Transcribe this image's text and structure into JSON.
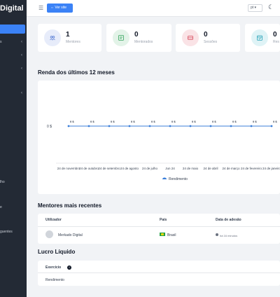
{
  "sidebar": {
    "brand": "Digital",
    "items": [
      {
        "label": "",
        "chevron": ""
      },
      {
        "label": "s",
        "chevron": "‹"
      },
      {
        "label": "",
        "chevron": "‹"
      },
      {
        "label": "",
        "chevron": "‹"
      },
      {
        "label": "",
        "chevron": "‹"
      },
      {
        "label": "lho",
        "chevron": ""
      },
      {
        "label": "e",
        "chevron": ""
      },
      {
        "label": "guentes",
        "chevron": ""
      }
    ]
  },
  "topbar": {
    "visit_label": "⇔ Ver site",
    "language": "pt ▾",
    "theme_icon": "moon-icon"
  },
  "stats": [
    {
      "value": "1",
      "label": "Mentores",
      "icon": "users-icon",
      "color": "#5b7fd6",
      "bg": "#e7ecfa"
    },
    {
      "value": "0",
      "label": "Mentorados",
      "icon": "user-card-icon",
      "color": "#33a35b",
      "bg": "#e3f3e8"
    },
    {
      "value": "0",
      "label": "Sessões",
      "icon": "session-icon",
      "color": "#d7485a",
      "bg": "#fae3e6"
    },
    {
      "value": "0",
      "label": "Res",
      "icon": "calendar-icon",
      "color": "#2aa3b8",
      "bg": "#dff3f6"
    }
  ],
  "income_section": {
    "title": "Renda dos últimos 12 meses"
  },
  "chart_data": {
    "type": "line",
    "title": "",
    "xlabel": "",
    "ylabel": "",
    "y_tick": "0 $",
    "legend": "Rendimento",
    "legend_position": "bottom",
    "color": "#3b7fd9",
    "grid": false,
    "categories": [
      "24 de novembro",
      "24 de outubro",
      "24 de setembro",
      "24 de agosto",
      "24 de julho",
      "Jun 24",
      "24 de maio",
      "24 de abril",
      "24 de março",
      "24 de fevereiro",
      "24 de janeiro"
    ],
    "point_labels": [
      "0 $",
      "0 $",
      "0 $",
      "0 $",
      "0 $",
      "0 $",
      "0 $",
      "0 $",
      "0 $",
      "0 $",
      "0 $"
    ],
    "series": [
      {
        "name": "Rendimento",
        "values": [
          0,
          0,
          0,
          0,
          0,
          0,
          0,
          0,
          0,
          0,
          0
        ]
      }
    ]
  },
  "mentors_section": {
    "title": "Mentores mais recentes",
    "headers": [
      "Utilizador",
      "País",
      "Data de adesão"
    ],
    "rows": [
      {
        "name": "Merkado Digital",
        "country": "Brasil",
        "joined": "há 16 minutos"
      }
    ]
  },
  "profit_section": {
    "title": "Lucro Líquido",
    "header": "Exercício",
    "row_label": "Rendimento"
  }
}
